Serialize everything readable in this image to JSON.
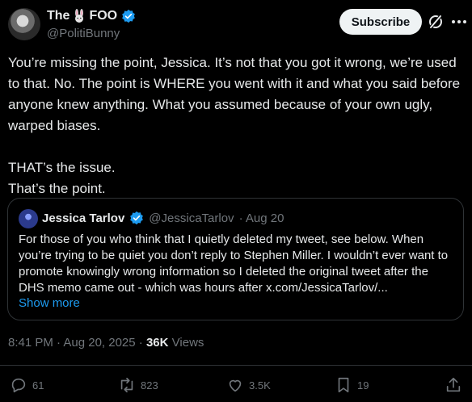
{
  "author": {
    "name_prefix": "The",
    "name_suffix": "FOO",
    "handle": "@PolitiBunny"
  },
  "header": {
    "subscribe_label": "Subscribe"
  },
  "tweet": {
    "text": "You’re missing the point, Jessica. It’s not that you got it wrong, we’re used to that. No. The point is WHERE you went with it and what you said before anyone knew anything. What you assumed because of your own ugly, warped biases.\n\nTHAT’s the issue.\nThat’s the point."
  },
  "quote": {
    "name": "Jessica Tarlov",
    "handle": "@JessicaTarlov",
    "date": "· Aug 20",
    "text": "For those of you who think that I quietly deleted my tweet, see below. When you’re trying to be quiet you don’t reply to Stephen Miller. I wouldn’t ever want to promote knowingly wrong information so I deleted the original tweet after the DHS memo came out - which was hours after x.com/JessicaTarlov/...",
    "show_more": "Show more"
  },
  "meta": {
    "timestamp": "8:41 PM · Aug 20, 2025 ·",
    "views_count": "36K",
    "views_label": "Views"
  },
  "actions": {
    "replies": "61",
    "reposts": "823",
    "likes": "3.5K",
    "bookmarks": "19"
  },
  "colors": {
    "background": "#000000",
    "accent": "#1d9bf0",
    "muted": "#71767b",
    "text": "#e7e9ea",
    "border": "#2f3336"
  },
  "icons": [
    "verified-badge-icon",
    "bunny-emoji-icon",
    "grok-icon",
    "more-icon",
    "reply-icon",
    "repost-icon",
    "like-icon",
    "bookmark-icon",
    "share-icon"
  ]
}
